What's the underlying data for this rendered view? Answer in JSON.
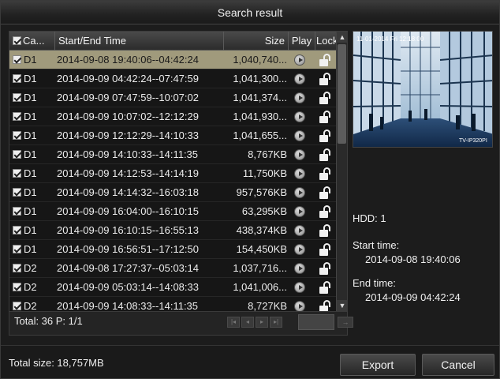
{
  "window": {
    "title": "Search result"
  },
  "table": {
    "columns": {
      "camera": "Ca...",
      "time": "Start/End Time",
      "size": "Size",
      "play": "Play",
      "lock": "Lock"
    },
    "rows": [
      {
        "camera": "D1",
        "time": "2014-09-08 19:40:06--04:42:24",
        "size": "1,040,740...",
        "selected": true
      },
      {
        "camera": "D1",
        "time": "2014-09-09 04:42:24--07:47:59",
        "size": "1,041,300...",
        "selected": false
      },
      {
        "camera": "D1",
        "time": "2014-09-09 07:47:59--10:07:02",
        "size": "1,041,374...",
        "selected": false
      },
      {
        "camera": "D1",
        "time": "2014-09-09 10:07:02--12:12:29",
        "size": "1,041,930...",
        "selected": false
      },
      {
        "camera": "D1",
        "time": "2014-09-09 12:12:29--14:10:33",
        "size": "1,041,655...",
        "selected": false
      },
      {
        "camera": "D1",
        "time": "2014-09-09 14:10:33--14:11:35",
        "size": "8,767KB",
        "selected": false
      },
      {
        "camera": "D1",
        "time": "2014-09-09 14:12:53--14:14:19",
        "size": "11,750KB",
        "selected": false
      },
      {
        "camera": "D1",
        "time": "2014-09-09 14:14:32--16:03:18",
        "size": "957,576KB",
        "selected": false
      },
      {
        "camera": "D1",
        "time": "2014-09-09 16:04:00--16:10:15",
        "size": "63,295KB",
        "selected": false
      },
      {
        "camera": "D1",
        "time": "2014-09-09 16:10:15--16:55:13",
        "size": "438,374KB",
        "selected": false
      },
      {
        "camera": "D1",
        "time": "2014-09-09 16:56:51--17:12:50",
        "size": "154,450KB",
        "selected": false
      },
      {
        "camera": "D2",
        "time": "2014-09-08 17:27:37--05:03:14",
        "size": "1,037,716...",
        "selected": false
      },
      {
        "camera": "D2",
        "time": "2014-09-09 05:03:14--14:08:33",
        "size": "1,041,006...",
        "selected": false
      },
      {
        "camera": "D2",
        "time": "2014-09-09 14:08:33--14:11:35",
        "size": "8,727KB",
        "selected": false
      }
    ],
    "footer": {
      "total": "Total: 36  P: 1/1"
    }
  },
  "preview": {
    "overlay_datetime": "11-01-2014 Fri 12:18:00",
    "overlay_camera": "TV-IP320PI"
  },
  "info": {
    "hdd": "HDD: 1",
    "start_label": "Start time:",
    "start_value": "2014-09-08 19:40:06",
    "end_label": "End time:",
    "end_value": "2014-09-09 04:42:24"
  },
  "status": {
    "total_size": "Total size: 18,757MB"
  },
  "buttons": {
    "export": "Export",
    "cancel": "Cancel"
  },
  "colors": {
    "selected_row": "#a09a7c",
    "background": "#1c1c1c"
  }
}
